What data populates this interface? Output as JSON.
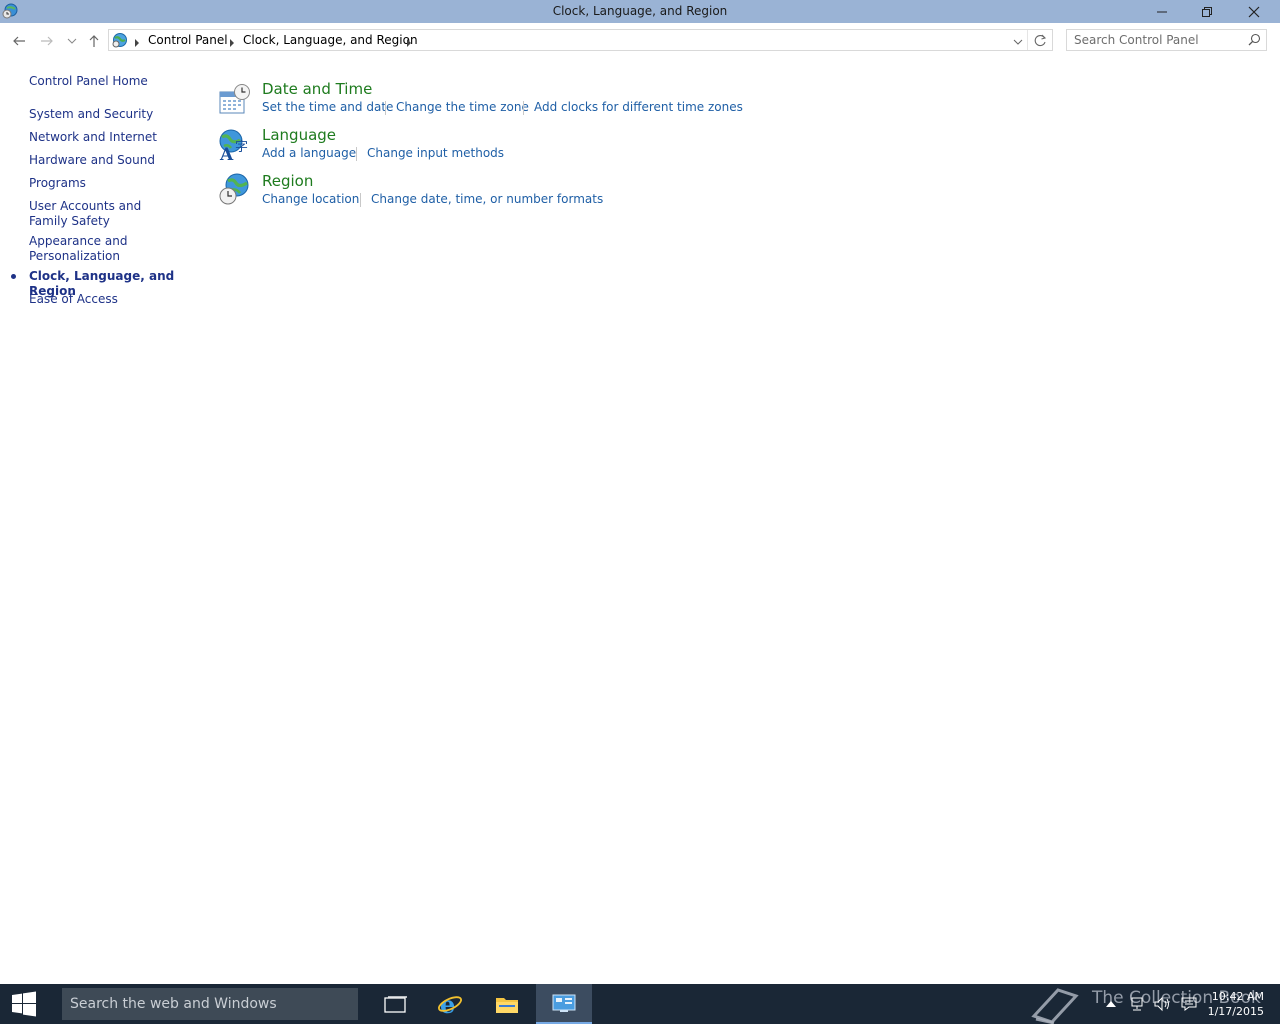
{
  "window": {
    "title": "Clock, Language, and Region"
  },
  "address": {
    "crumbs": [
      "Control Panel",
      "Clock, Language, and Region"
    ]
  },
  "search": {
    "placeholder": "Search Control Panel"
  },
  "sidebar": {
    "home": "Control Panel Home",
    "items": [
      {
        "label": "System and Security"
      },
      {
        "label": "Network and Internet"
      },
      {
        "label": "Hardware and Sound"
      },
      {
        "label": "Programs"
      },
      {
        "label": "User Accounts and Family Safety"
      },
      {
        "label": "Appearance and Personalization"
      },
      {
        "label": "Clock, Language, and Region",
        "current": true
      },
      {
        "label": "Ease of Access"
      }
    ]
  },
  "categories": [
    {
      "title": "Date and Time",
      "icon": "calendar-clock-icon",
      "links": [
        "Set the time and date",
        "Change the time zone",
        "Add clocks for different time zones"
      ]
    },
    {
      "title": "Language",
      "icon": "language-globe-icon",
      "links": [
        "Add a language",
        "Change input methods"
      ]
    },
    {
      "title": "Region",
      "icon": "region-globe-clock-icon",
      "links": [
        "Change location",
        "Change date, time, or number formats"
      ]
    }
  ],
  "taskbar": {
    "search_placeholder": "Search the web and Windows",
    "watermark": "The Collection Book",
    "time": "10:42 AM",
    "date": "1/17/2015"
  },
  "colors": {
    "titlebar": "#9ab3d5",
    "taskbar": "#1a2736",
    "link": "#1f5fa6",
    "category_title": "#1e7b1e",
    "sidebar_link": "#1e3287"
  }
}
